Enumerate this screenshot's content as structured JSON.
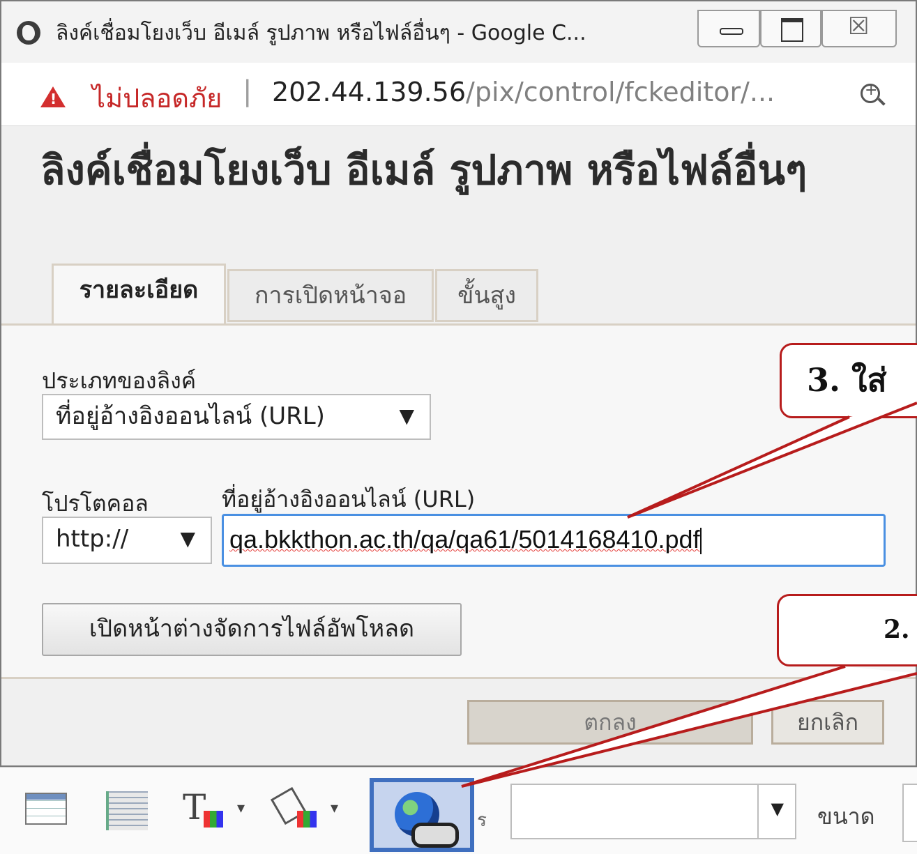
{
  "window": {
    "title": "ลิงค์เชื่อมโยงเว็บ อีเมล์ รูปภาพ หรือไฟล์อื่นๆ - Google C...",
    "buttons": {
      "minimize_icon": "minimize-icon",
      "maximize_icon": "maximize-icon",
      "close_glyph": "☒"
    }
  },
  "addressbar": {
    "security_label": "ไม่ปลอดภัย",
    "host": "202.44.139.56",
    "path": "/pix/control/fckeditor/..."
  },
  "dialog": {
    "title": "ลิงค์เชื่อมโยงเว็บ อีเมล์ รูปภาพ หรือไฟล์อื่นๆ",
    "tabs": [
      {
        "label": "รายละเอียด",
        "active": true
      },
      {
        "label": "การเปิดหน้าจอ",
        "active": false
      },
      {
        "label": "ขั้นสูง",
        "active": false
      }
    ],
    "link_type": {
      "label": "ประเภทของลิงค์",
      "value": "ที่อยู่อ้างอิงออนไลน์ (URL)",
      "arrow": "▼"
    },
    "protocol": {
      "label": "โปรโตคอล",
      "value": "http://",
      "arrow": "▼"
    },
    "url": {
      "label": "ที่อยู่อ้างอิงออนไลน์ (URL)",
      "value": "qa.bkkthon.ac.th/qa/qa61/5014168410.pdf"
    },
    "upload_button": "เปิดหน้าต่างจัดการไฟล์อัพโหลด",
    "ok_button": "ตกลง",
    "cancel_button": "ยกเลิก"
  },
  "toolbar": {
    "font_label_fragment": "ร",
    "font_value": "",
    "font_arrow": "▼",
    "size_label": "ขนาด",
    "dropdown_glyph": "▾"
  },
  "annotations": {
    "callout3": "3. ใส่",
    "callout2": "2.",
    "accent_color": "#b71c1c"
  },
  "colors": {
    "warning": "#d32f2f",
    "focus_border": "#4a90e2",
    "highlight": "#3f6fbf"
  }
}
